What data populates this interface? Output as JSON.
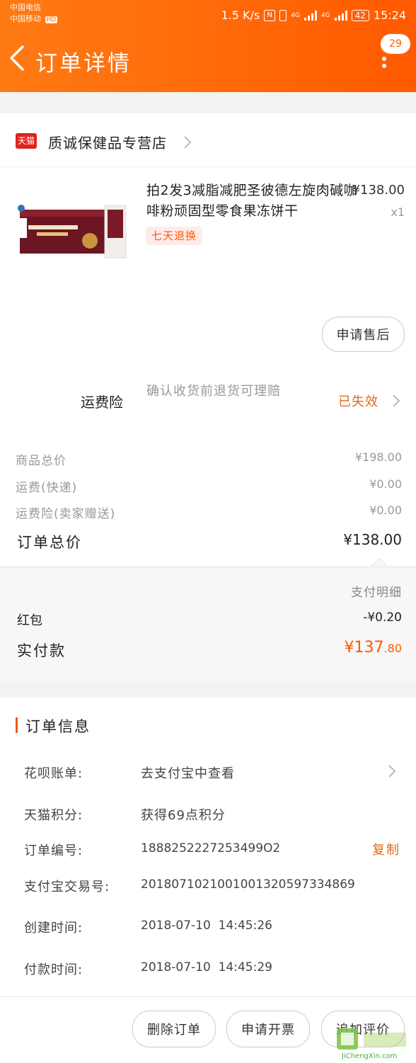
{
  "status_bar": {
    "carrier_1": "中国电信",
    "carrier_2": "中国移动",
    "hd_badge": "HD",
    "net_speed": "1.5 K/s",
    "network_1": "4G",
    "network_2": "4G",
    "battery": "42",
    "time": "15:24"
  },
  "header": {
    "title": "订单详情",
    "message_count": "29",
    "back_icon": "chevron-left-icon",
    "more_icon": "more-vertical-icon"
  },
  "shop": {
    "platform_tag": "天猫",
    "name": "质诚保健品专营店"
  },
  "product": {
    "title": "拍2发3减脂减肥圣彼德左旋肉碱咖啡粉顽固型零食果冻饼干",
    "price": "¥138.00",
    "quantity": "x1",
    "tag": "七天退换",
    "after_sale_button": "申请售后"
  },
  "insurance": {
    "label": "运费险",
    "description": "确认收货前退货可理赔",
    "status": "已失效"
  },
  "summary": {
    "rows": [
      {
        "label": "商品总价",
        "value": "¥198.00"
      },
      {
        "label": "运费(快递)",
        "value": "¥0.00"
      },
      {
        "label": "运费险(卖家赠送)",
        "value": "¥0.00"
      }
    ],
    "total_label": "订单总价",
    "total_value": "¥138.00"
  },
  "payment": {
    "detail_link": "支付明细",
    "red_packet_label": "红包",
    "red_packet_value": "-¥0.20",
    "paid_label": "实付款",
    "paid_value_main": "¥137",
    "paid_value_cents": ".80"
  },
  "order_info": {
    "title": "订单信息",
    "rows": [
      {
        "label": "花呗账单:",
        "value": "去支付宝中查看"
      },
      {
        "label": "天猫积分:",
        "value": "获得69点积分"
      },
      {
        "label": "订单编号:",
        "value": "1888252227253499O2"
      },
      {
        "label": "支付宝交易号:",
        "value": "2018071021001001320597334869"
      },
      {
        "label": "创建时间:",
        "value": "2018-07-10  14:45:26"
      },
      {
        "label": "付款时间:",
        "value": "2018-07-10  14:45:29"
      }
    ],
    "copy_button": "复制"
  },
  "footer": {
    "delete_button": "删除订单",
    "invoice_button": "申请开票",
    "review_button": "追加评价"
  },
  "watermark": {
    "text": "JiChengXin.com"
  },
  "colors": {
    "brand_orange": "#ff5a00",
    "tmall_red": "#e0231e",
    "accent_text": "#e06b1a"
  }
}
